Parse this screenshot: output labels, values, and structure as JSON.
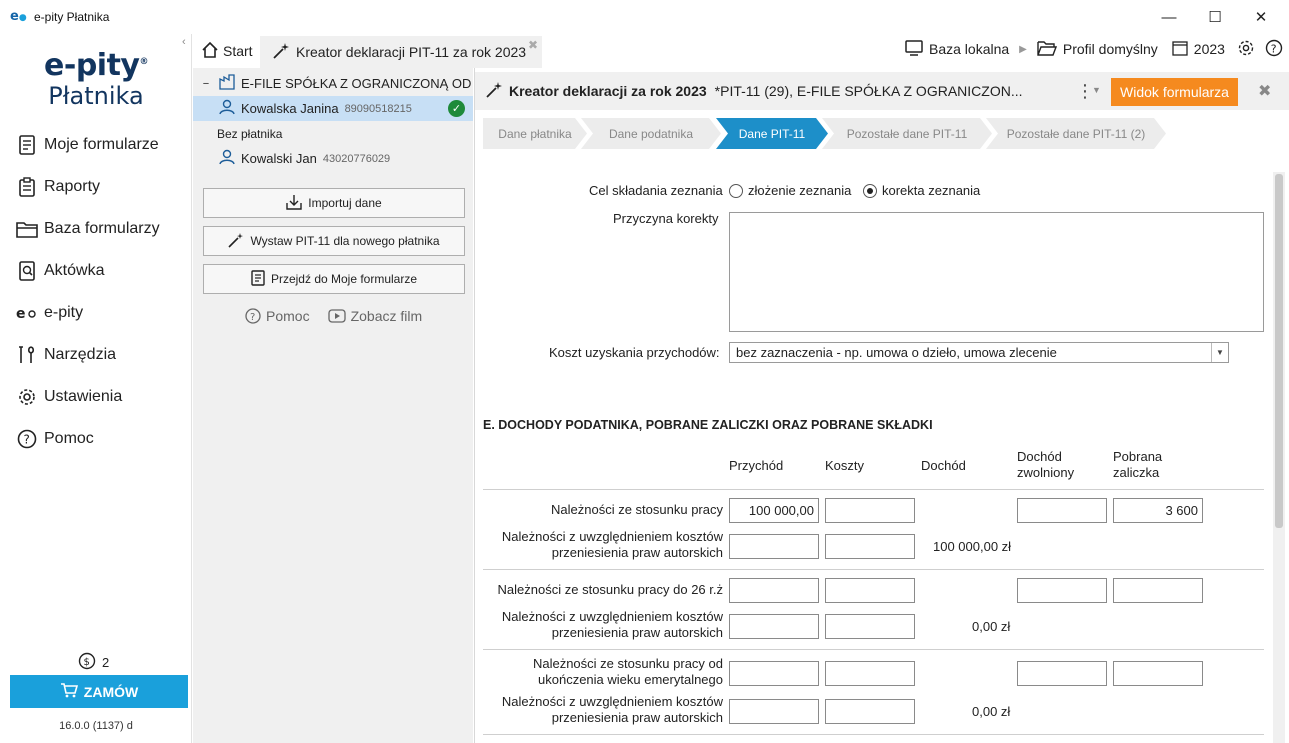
{
  "window": {
    "app_icon_text": "e",
    "title": "e-pity Płatnika",
    "minimize": "—",
    "maximize": "☐",
    "close": "✕"
  },
  "sidebar": {
    "brand_line1": "e-pity",
    "brand_reg": "®",
    "brand_line2": "Płatnika",
    "collapse": "‹",
    "items": [
      {
        "label": "Moje formularze",
        "icon": "form-icon"
      },
      {
        "label": "Raporty",
        "icon": "clipboard-icon"
      },
      {
        "label": "Baza formularzy",
        "icon": "folder-icon"
      },
      {
        "label": "Aktówka",
        "icon": "briefcase-icon"
      },
      {
        "label": "e-pity",
        "icon": "epity-icon"
      },
      {
        "label": "Narzędzia",
        "icon": "tools-icon"
      },
      {
        "label": "Ustawienia",
        "icon": "gear-icon"
      },
      {
        "label": "Pomoc",
        "icon": "help-icon"
      }
    ],
    "coins_count": "2",
    "order_label": "ZAMÓW",
    "version": "16.0.0 (1137) d"
  },
  "tabs": {
    "start": "Start",
    "kreator": "Kreator deklaracji PIT-11 za rok 2023",
    "kreator_close": "✖"
  },
  "topbar": {
    "baza": "Baza lokalna",
    "profil": "Profil domyślny",
    "year": "2023"
  },
  "tree": {
    "company": "E-FILE SPÓŁKA Z OGRANICZONĄ ODPO",
    "person1_name": "Kowalska Janina",
    "person1_pesel": "89090518215",
    "bez_platnika": "Bez płatnika",
    "person2_name": "Kowalski Jan",
    "person2_pesel": "43020776029",
    "minus": "−"
  },
  "actions": {
    "import": "Importuj dane",
    "wystaw": "Wystaw PIT-11 dla nowego płatnika",
    "przejdz": "Przejdź do Moje formularze",
    "pomoc": "Pomoc",
    "film": "Zobacz film"
  },
  "header": {
    "title": "Kreator deklaracji za rok 2023",
    "subtitle": "*PIT-11 (29), E-FILE SPÓŁKA Z OGRANICZON...",
    "widok": "Widok formularza",
    "close": "✖"
  },
  "steps": [
    "Dane płatnika",
    "Dane podatnika",
    "Dane PIT-11",
    "Pozostałe dane PIT-11",
    "Pozostałe dane PIT-11 (2)"
  ],
  "form": {
    "cel_label": "Cel składania zeznania",
    "opt1": "złożenie zeznania",
    "opt2": "korekta zeznania",
    "przyczyna_label": "Przyczyna korekty",
    "koszt_label": "Koszt uzyskania przychodów:",
    "koszt_value": "bez zaznaczenia - np. umowa o dzieło, umowa zlecenie",
    "section_e": "E. DOCHODY PODATNIKA, POBRANE ZALICZKI ORAZ POBRANE SKŁADKI",
    "col_przychod": "Przychód",
    "col_koszty": "Koszty",
    "col_dochod": "Dochód",
    "col_zwolniony_1": "Dochód",
    "col_zwolniony_2": "zwolniony",
    "col_zaliczka_1": "Pobrana",
    "col_zaliczka_2": "zaliczka",
    "row1_label": "Należności ze stosunku pracy",
    "row1_przychod": "100 000,00",
    "row1_zaliczka": "3 600",
    "row1b_label_1": "Należności z uwzględnieniem kosztów",
    "row1b_label_2": "przeniesienia praw autorskich",
    "row1_dochod": "100 000,00 zł",
    "row2_label": "Należności ze stosunku pracy do 26 r.ż",
    "row2b_label_1": "Należności z uwzględnieniem kosztów",
    "row2b_label_2": "przeniesienia praw autorskich",
    "row2_dochod": "0,00 zł",
    "row3_label_1": "Należności ze stosunku pracy od",
    "row3_label_2": "ukończenia wieku emerytalnego",
    "row3b_label_1": "Należności z uwzględnieniem kosztów",
    "row3b_label_2": "przeniesienia praw autorskich",
    "row3_dochod": "0,00 zł"
  }
}
